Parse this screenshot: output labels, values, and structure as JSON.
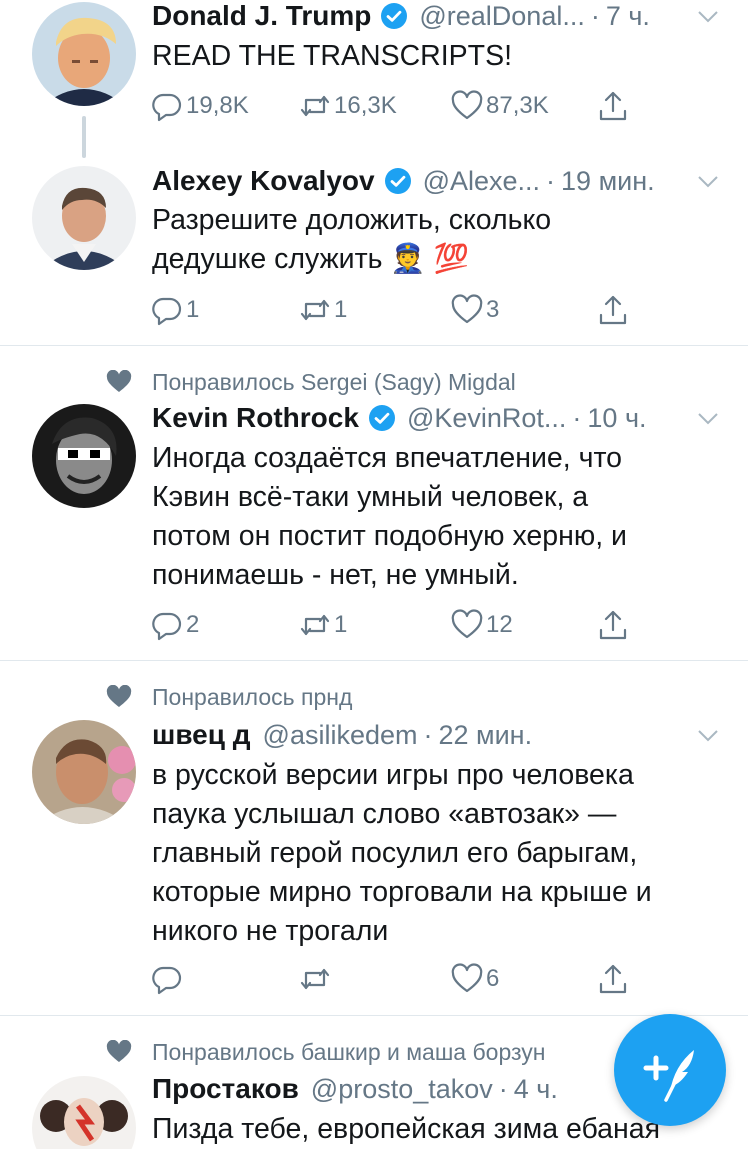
{
  "colors": {
    "accent": "#1da1f2",
    "muted": "#657786",
    "text": "#14171a",
    "divider": "#e1e8ed"
  },
  "tweets": [
    {
      "name": "Donald J. Trump",
      "verified": true,
      "handle": "@realDonal...",
      "time": "7 ч.",
      "text_lines": [
        "READ THE TRANSCRIPTS!"
      ],
      "replies": "19,8K",
      "retweets": "16,3K",
      "likes": "87,3K"
    },
    {
      "name": "Alexey Kovalyov",
      "verified": true,
      "handle": "@Alexe...",
      "time": "19 мин.",
      "text_lines": [
        "Разрешите доложить, сколько",
        "дедушке служить 👮 💯"
      ],
      "replies": "1",
      "retweets": "1",
      "likes": "3"
    },
    {
      "liked_by": "Понравилось Sergei (Sagy) Migdal",
      "name": "Kevin Rothrock",
      "verified": true,
      "handle": "@KevinRot...",
      "time": "10 ч.",
      "text_lines": [
        "Иногда создаётся впечатление, что",
        "Кэвин всё-таки умный человек, а",
        "потом он постит подобную херню, и",
        "понимаешь - нет, не умный."
      ],
      "replies": "2",
      "retweets": "1",
      "likes": "12"
    },
    {
      "liked_by": "Понравилось прнд",
      "name": "швец д",
      "verified": false,
      "handle": "@asilikedem",
      "time": "22 мин.",
      "text_lines": [
        "в русской версии игры про человека",
        "паука услышал слово «автозак» —",
        "главный герой посулил его барыгам,",
        "которые мирно торговали на крыше и",
        "никого не трогали"
      ],
      "replies": "",
      "retweets": "",
      "likes": "6"
    },
    {
      "liked_by": "Понравилось башкир и маша борзун",
      "name": "Простаков",
      "verified": false,
      "handle": "@prosto_takov",
      "time": "4 ч.",
      "text_lines": [
        "Пизда тебе, европейская зима ебаная"
      ]
    }
  ],
  "icons": {
    "reply": "reply-icon",
    "retweet": "retweet-icon",
    "like": "heart-icon",
    "share": "share-icon",
    "more": "chevron-down-icon",
    "verified": "verified-badge-icon",
    "compose": "compose-tweet-icon"
  }
}
